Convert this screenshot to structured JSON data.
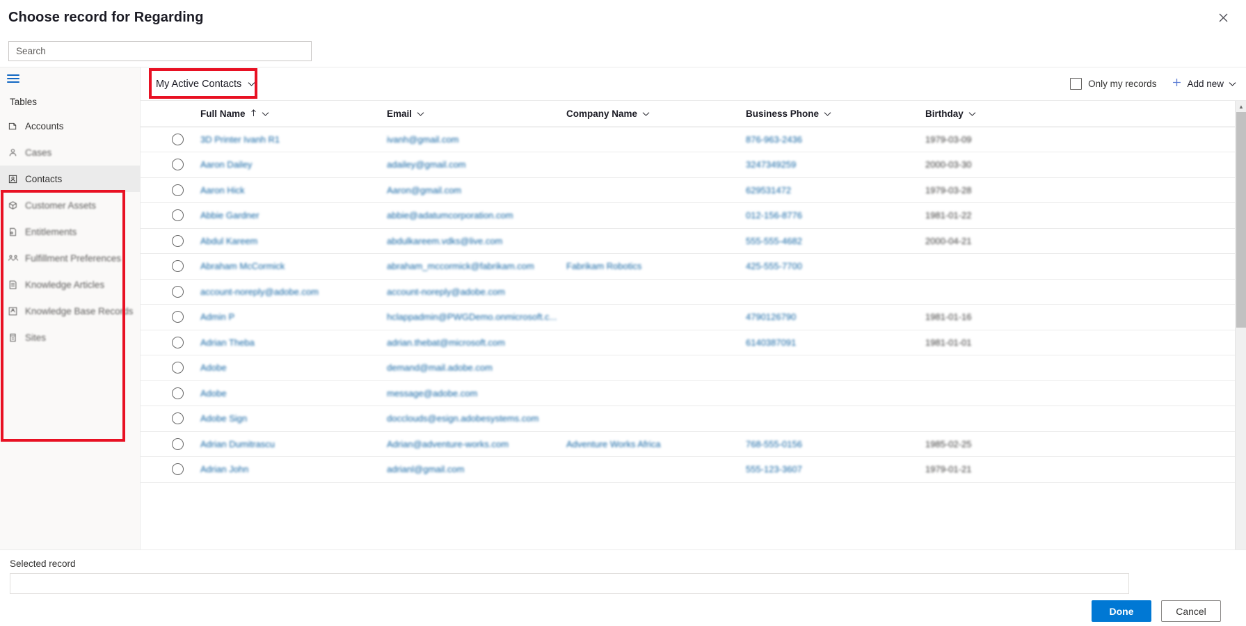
{
  "dialog": {
    "title": "Choose record for Regarding",
    "close_label": "Close"
  },
  "search": {
    "placeholder": "Search",
    "value": ""
  },
  "sidebar": {
    "menu_icon": "hamburger-icon",
    "heading": "Tables",
    "items": [
      {
        "label": "Accounts",
        "icon": "account-icon",
        "selected": false,
        "blurred": false
      },
      {
        "label": "Cases",
        "icon": "case-icon",
        "selected": false,
        "blurred": true
      },
      {
        "label": "Contacts",
        "icon": "contact-icon",
        "selected": true,
        "blurred": false
      },
      {
        "label": "Customer Assets",
        "icon": "box-icon",
        "selected": false,
        "blurred": true
      },
      {
        "label": "Entitlements",
        "icon": "entitlement-icon",
        "selected": false,
        "blurred": true
      },
      {
        "label": "Fulfillment Preferences",
        "icon": "people-icon",
        "selected": false,
        "blurred": true
      },
      {
        "label": "Knowledge Articles",
        "icon": "document-icon",
        "selected": false,
        "blurred": true
      },
      {
        "label": "Knowledge Base Records",
        "icon": "kb-icon",
        "selected": false,
        "blurred": true
      },
      {
        "label": "Sites",
        "icon": "building-icon",
        "selected": false,
        "blurred": true
      }
    ]
  },
  "commandbar": {
    "view_name": "My Active Contacts",
    "view_chevron": "chevron-down-icon",
    "only_my_records_label": "Only my records",
    "only_my_records_checked": false,
    "add_new_label": "Add new",
    "add_new_plus": "plus-icon",
    "add_new_chevron": "chevron-down-icon"
  },
  "grid": {
    "columns": [
      {
        "key": "select",
        "label": ""
      },
      {
        "key": "fullname",
        "label": "Full Name",
        "sort": "ascending",
        "sort_icon": "arrow-up-icon",
        "menu_icon": "chevron-down-icon"
      },
      {
        "key": "email",
        "label": "Email",
        "menu_icon": "chevron-down-icon"
      },
      {
        "key": "company",
        "label": "Company Name",
        "menu_icon": "chevron-down-icon"
      },
      {
        "key": "phone",
        "label": "Business Phone",
        "menu_icon": "chevron-down-icon"
      },
      {
        "key": "birthday",
        "label": "Birthday",
        "menu_icon": "chevron-down-icon"
      }
    ],
    "rows": [
      {
        "fullname": "3D Printer Ivanh R1",
        "email": "ivanh@gmail.com",
        "company": "",
        "phone": "876-963-2436",
        "birthday": "1979-03-09"
      },
      {
        "fullname": "Aaron Dailey",
        "email": "adailey@gmail.com",
        "company": "",
        "phone": "3247349259",
        "birthday": "2000-03-30"
      },
      {
        "fullname": "Aaron Hick",
        "email": "Aaron@gmail.com",
        "company": "",
        "phone": "629531472",
        "birthday": "1979-03-28"
      },
      {
        "fullname": "Abbie Gardner",
        "email": "abbie@adatumcorporation.com",
        "company": "",
        "phone": "012-156-8776",
        "birthday": "1981-01-22"
      },
      {
        "fullname": "Abdul Kareem",
        "email": "abdulkareem.vdks@live.com",
        "company": "",
        "phone": "555-555-4682",
        "birthday": "2000-04-21"
      },
      {
        "fullname": "Abraham McCormick",
        "email": "abraham_mccormick@fabrikam.com",
        "company": "Fabrikam Robotics",
        "phone": "425-555-7700",
        "birthday": ""
      },
      {
        "fullname": "account-noreply@adobe.com",
        "email": "account-noreply@adobe.com",
        "company": "",
        "phone": "",
        "birthday": ""
      },
      {
        "fullname": "Admin P",
        "email": "hclappadmin@PWGDemo.onmicrosoft.c...",
        "company": "",
        "phone": "4790126790",
        "birthday": "1981-01-16"
      },
      {
        "fullname": "Adrian Theba",
        "email": "adrian.thebat@microsoft.com",
        "company": "",
        "phone": "6140387091",
        "birthday": "1981-01-01"
      },
      {
        "fullname": "Adobe",
        "email": "demand@mail.adobe.com",
        "company": "",
        "phone": "",
        "birthday": ""
      },
      {
        "fullname": "Adobe",
        "email": "message@adobe.com",
        "company": "",
        "phone": "",
        "birthday": ""
      },
      {
        "fullname": "Adobe Sign",
        "email": "docclouds@esign.adobesystems.com",
        "company": "",
        "phone": "",
        "birthday": ""
      },
      {
        "fullname": "Adrian Dumitrascu",
        "email": "Adrian@adventure-works.com",
        "company": "Adventure Works Africa",
        "phone": "768-555-0156",
        "birthday": "1985-02-25"
      },
      {
        "fullname": "Adrian John",
        "email": "adrianl@gmail.com",
        "company": "",
        "phone": "555-123-3607",
        "birthday": "1979-01-21"
      }
    ]
  },
  "footer": {
    "selected_record_label": "Selected record",
    "selected_record_value": "",
    "done_label": "Done",
    "cancel_label": "Cancel"
  },
  "colors": {
    "accent": "#0078d4",
    "link": "#1264a3",
    "highlight_box": "#e81123",
    "sidebar_bg": "#faf9f8"
  }
}
